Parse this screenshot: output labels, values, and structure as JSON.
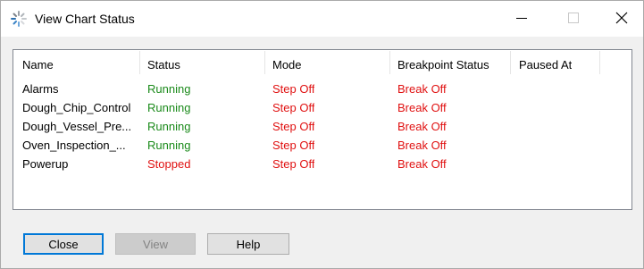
{
  "window": {
    "title": "View Chart Status",
    "minimize_icon": "minimize-icon",
    "maximize_icon": "maximize-icon",
    "close_icon": "close-icon",
    "app_icon": "chart-status-icon"
  },
  "table": {
    "columns": [
      "Name",
      "Status",
      "Mode",
      "Breakpoint Status",
      "Paused At"
    ],
    "rows": [
      {
        "name": "Alarms",
        "status": "Running",
        "mode": "Step Off",
        "breakpoint": "Break Off",
        "paused_at": ""
      },
      {
        "name": "Dough_Chip_Control",
        "status": "Running",
        "mode": "Step Off",
        "breakpoint": "Break Off",
        "paused_at": ""
      },
      {
        "name": "Dough_Vessel_Pre...",
        "status": "Running",
        "mode": "Step Off",
        "breakpoint": "Break Off",
        "paused_at": ""
      },
      {
        "name": "Oven_Inspection_...",
        "status": "Running",
        "mode": "Step Off",
        "breakpoint": "Break Off",
        "paused_at": ""
      },
      {
        "name": "Powerup",
        "status": "Stopped",
        "mode": "Step Off",
        "breakpoint": "Break Off",
        "paused_at": ""
      }
    ]
  },
  "buttons": {
    "close": "Close",
    "view": "View",
    "help": "Help"
  },
  "colors": {
    "running": "#1a8a1a",
    "stopped": "#e01010",
    "mode": "#e01010",
    "breakpoint": "#e01010"
  }
}
